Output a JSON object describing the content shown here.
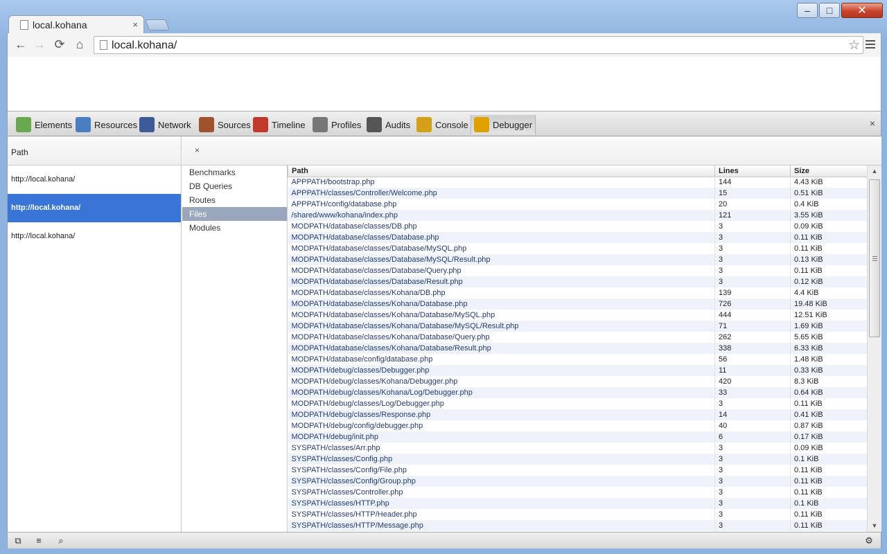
{
  "window": {
    "controls": {
      "minimize": "–",
      "maximize": "□",
      "close": "✕"
    }
  },
  "browser": {
    "tab_title": "local.kohana",
    "tab_close": "×",
    "url": "local.kohana/",
    "nav": {
      "back": "←",
      "forward": "→",
      "reload": "⟳",
      "home": "⌂",
      "star": "☆"
    }
  },
  "devtools": {
    "tabs": [
      {
        "label": "Elements",
        "icon": "elements-icon",
        "color": "#6aa84f"
      },
      {
        "label": "Resources",
        "icon": "resources-icon",
        "color": "#4a7ec2"
      },
      {
        "label": "Network",
        "icon": "network-icon",
        "color": "#3d5a99"
      },
      {
        "label": "Sources",
        "icon": "sources-icon",
        "color": "#a0522d"
      },
      {
        "label": "Timeline",
        "icon": "timeline-icon",
        "color": "#c0392b"
      },
      {
        "label": "Profiles",
        "icon": "profiles-icon",
        "color": "#777777"
      },
      {
        "label": "Audits",
        "icon": "audits-icon",
        "color": "#555555"
      },
      {
        "label": "Console",
        "icon": "console-icon",
        "color": "#d4a017"
      },
      {
        "label": "Debugger",
        "icon": "debugger-icon",
        "color": "#e0a000"
      }
    ],
    "active_tab": "Debugger",
    "close_glyph": "×",
    "path_header": "Path",
    "panel_close": "×",
    "requests": [
      "http://local.kohana/",
      "http://local.kohana/",
      "http://local.kohana/"
    ],
    "selected_request": 1,
    "sections": [
      "Benchmarks",
      "DB Queries",
      "Routes",
      "Files",
      "Modules"
    ],
    "selected_section": 3,
    "files": {
      "headers": [
        "Path",
        "Lines",
        "Size"
      ],
      "rows": [
        [
          "APPPATH/bootstrap.php",
          "144",
          "4.43 KiB"
        ],
        [
          "APPPATH/classes/Controller/Welcome.php",
          "15",
          "0.51 KiB"
        ],
        [
          "APPPATH/config/database.php",
          "20",
          "0.4 KiB"
        ],
        [
          "/shared/www/kohana/index.php",
          "121",
          "3.55 KiB"
        ],
        [
          "MODPATH/database/classes/DB.php",
          "3",
          "0.09 KiB"
        ],
        [
          "MODPATH/database/classes/Database.php",
          "3",
          "0.11 KiB"
        ],
        [
          "MODPATH/database/classes/Database/MySQL.php",
          "3",
          "0.11 KiB"
        ],
        [
          "MODPATH/database/classes/Database/MySQL/Result.php",
          "3",
          "0.13 KiB"
        ],
        [
          "MODPATH/database/classes/Database/Query.php",
          "3",
          "0.11 KiB"
        ],
        [
          "MODPATH/database/classes/Database/Result.php",
          "3",
          "0.12 KiB"
        ],
        [
          "MODPATH/database/classes/Kohana/DB.php",
          "139",
          "4.4 KiB"
        ],
        [
          "MODPATH/database/classes/Kohana/Database.php",
          "726",
          "19.48 KiB"
        ],
        [
          "MODPATH/database/classes/Kohana/Database/MySQL.php",
          "444",
          "12.51 KiB"
        ],
        [
          "MODPATH/database/classes/Kohana/Database/MySQL/Result.php",
          "71",
          "1.69 KiB"
        ],
        [
          "MODPATH/database/classes/Kohana/Database/Query.php",
          "262",
          "5.65 KiB"
        ],
        [
          "MODPATH/database/classes/Kohana/Database/Result.php",
          "338",
          "6.33 KiB"
        ],
        [
          "MODPATH/database/config/database.php",
          "56",
          "1.48 KiB"
        ],
        [
          "MODPATH/debug/classes/Debugger.php",
          "11",
          "0.33 KiB"
        ],
        [
          "MODPATH/debug/classes/Kohana/Debugger.php",
          "420",
          "8.3 KiB"
        ],
        [
          "MODPATH/debug/classes/Kohana/Log/Debugger.php",
          "33",
          "0.64 KiB"
        ],
        [
          "MODPATH/debug/classes/Log/Debugger.php",
          "3",
          "0.11 KiB"
        ],
        [
          "MODPATH/debug/classes/Response.php",
          "14",
          "0.41 KiB"
        ],
        [
          "MODPATH/debug/config/debugger.php",
          "40",
          "0.87 KiB"
        ],
        [
          "MODPATH/debug/init.php",
          "6",
          "0.17 KiB"
        ],
        [
          "SYSPATH/classes/Arr.php",
          "3",
          "0.09 KiB"
        ],
        [
          "SYSPATH/classes/Config.php",
          "3",
          "0.1 KiB"
        ],
        [
          "SYSPATH/classes/Config/File.php",
          "3",
          "0.11 KiB"
        ],
        [
          "SYSPATH/classes/Config/Group.php",
          "3",
          "0.11 KiB"
        ],
        [
          "SYSPATH/classes/Controller.php",
          "3",
          "0.11 KiB"
        ],
        [
          "SYSPATH/classes/HTTP.php",
          "3",
          "0.1 KiB"
        ],
        [
          "SYSPATH/classes/HTTP/Header.php",
          "3",
          "0.11 KiB"
        ],
        [
          "SYSPATH/classes/HTTP/Message.php",
          "3",
          "0.11 KiB"
        ]
      ]
    },
    "scrollbar": {
      "up": "▲",
      "down": "▼"
    },
    "status_bar": {
      "dock": "⧉",
      "console": "≡",
      "search": "⌕",
      "settings": "⚙"
    }
  }
}
